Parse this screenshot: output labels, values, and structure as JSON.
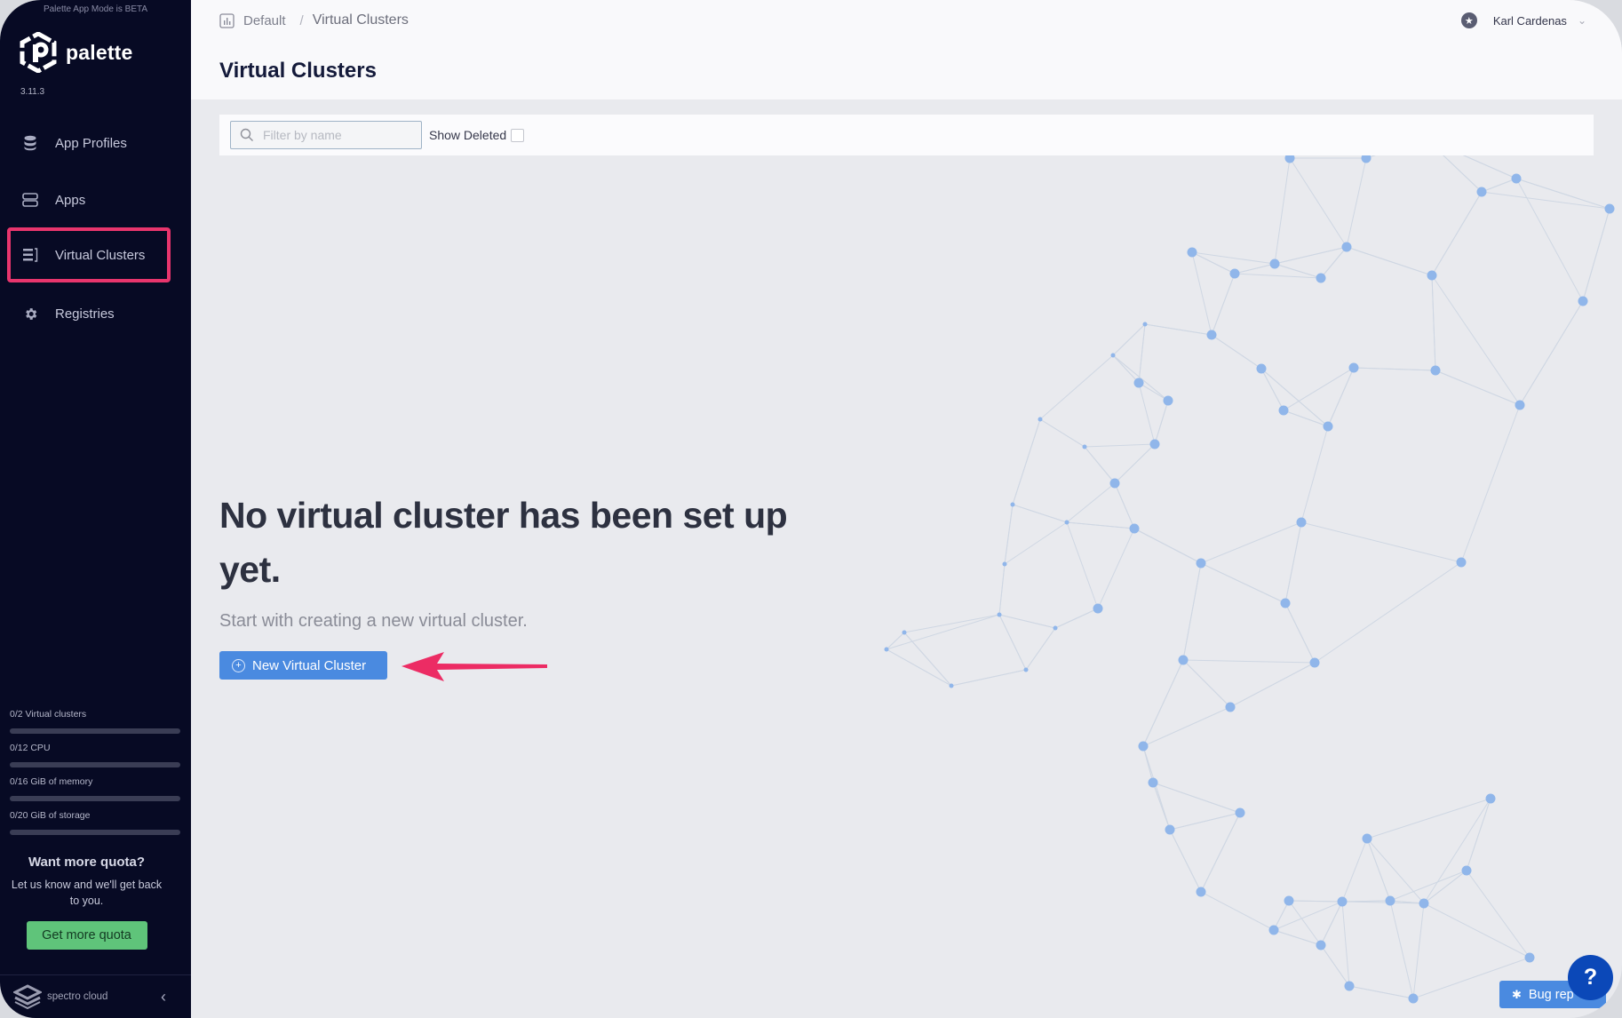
{
  "app": {
    "beta_note": "Palette App Mode is BETA",
    "logo_text": "palette",
    "version": "3.11.3"
  },
  "sidebar": {
    "items": [
      {
        "label": "App Profiles",
        "icon": "database-stack-icon",
        "active": false
      },
      {
        "label": "Apps",
        "icon": "server-icon",
        "active": false
      },
      {
        "label": "Virtual Clusters",
        "icon": "cluster-list-icon",
        "active": true
      },
      {
        "label": "Registries",
        "icon": "gear-icon",
        "active": false
      }
    ],
    "quotas": [
      {
        "label": "0/2 Virtual clusters",
        "used": 0,
        "total": 2
      },
      {
        "label": "0/12 CPU",
        "used": 0,
        "total": 12
      },
      {
        "label": "0/16 GiB of memory",
        "used": 0,
        "total": 16
      },
      {
        "label": "0/20 GiB of storage",
        "used": 0,
        "total": 20
      }
    ],
    "more_quota": {
      "title": "Want more quota?",
      "text": "Let us know and we'll get back to you.",
      "button": "Get more quota"
    },
    "footer": {
      "brand": "spectro cloud",
      "collapse_glyph": "‹"
    }
  },
  "header": {
    "breadcrumb": [
      "Default",
      "/",
      "Virtual Clusters"
    ],
    "title": "Virtual Clusters",
    "user_name": "Karl Cardenas",
    "user_icon_glyph": "★",
    "user_chevron": "⌄"
  },
  "toolbar": {
    "search_placeholder": "Filter by name",
    "search_value": "",
    "show_deleted_label": "Show Deleted",
    "show_deleted_checked": false
  },
  "empty_state": {
    "title": "No virtual cluster has been set up yet.",
    "subtitle": "Start with creating a new virtual cluster.",
    "button": "New Virtual Cluster",
    "button_icon": "+"
  },
  "floating": {
    "bug_report_label": "Bug rep",
    "bug_icon_glyph": "✱",
    "help_glyph": "?"
  },
  "colors": {
    "sidebar_bg": "#070a24",
    "highlight": "#e8356d",
    "primary": "#4a8ae0",
    "success": "#5fc47a",
    "help": "#0b48b8"
  }
}
